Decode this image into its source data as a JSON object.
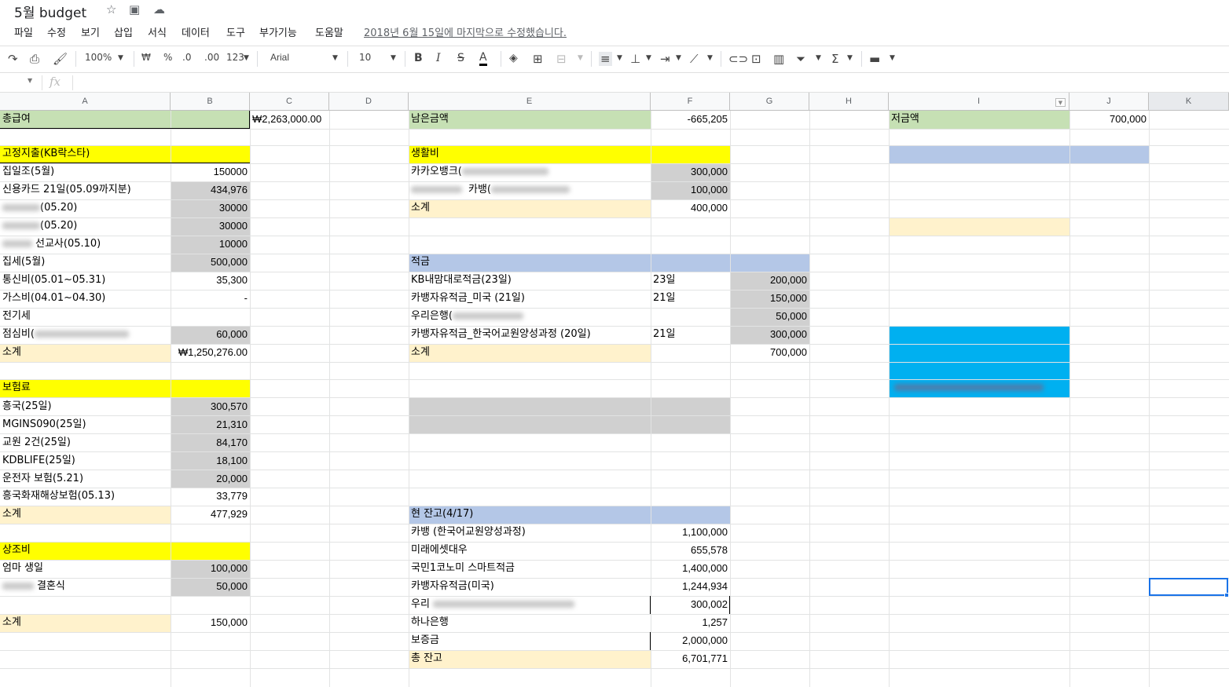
{
  "app": {
    "title": "5월 budget",
    "menus": [
      "파일",
      "수정",
      "보기",
      "삽입",
      "서식",
      "데이터",
      "도구",
      "부가기능",
      "도움말"
    ],
    "last_edit": "2018년 6월 15일에 마지막으로 수정했습니다."
  },
  "toolbar": {
    "zoom": "100%",
    "currency": "₩",
    "percent": "%",
    "dec_less": ".0",
    "dec_more": ".00",
    "format": "123",
    "font": "Arial",
    "font_size": "10"
  },
  "columns": [
    "A",
    "B",
    "C",
    "D",
    "E",
    "F",
    "G",
    "H",
    "I",
    "J",
    "K"
  ],
  "cells": {
    "a_total_pay": "총급여",
    "c_total_pay": "₩2,263,000.00",
    "e_remaining": "남은금액",
    "f_remaining": "-665,205",
    "i_savings": "저금액",
    "j_savings": "700,000",
    "a_fixed": "고정지출(KB락스타)",
    "a_r1": "집일조(5월)",
    "b_r1": "150000",
    "a_r2": "신용카드 21일(05.09까지분)",
    "b_r2": "434,976",
    "a_r3": "(05.20)",
    "b_r3": "30000",
    "a_r4": "(05.20)",
    "b_r4": "30000",
    "a_r5": "선교사(05.10)",
    "b_r5": "10000",
    "a_r6": "집세(5월)",
    "b_r6": "500,000",
    "a_r7": "통신비(05.01~05.31)",
    "b_r7": "35,300",
    "a_r8": "가스비(04.01~04.30)",
    "b_r8": "-",
    "a_r9": "전기세",
    "a_r10": "점심비(",
    "b_r10": "60,000",
    "a_sub1": "소계",
    "b_sub1": "₩1,250,276.00",
    "a_ins": "보험료",
    "a_i1": "흥국(25일)",
    "b_i1": "300,570",
    "a_i2": "MGINS090(25일)",
    "b_i2": "21,310",
    "a_i3": "교원 2건(25일)",
    "b_i3": "84,170",
    "a_i4": "KDBLIFE(25일)",
    "b_i4": "18,100",
    "a_i5": "운전자 보험(5.21)",
    "b_i5": "20,000",
    "a_i6": "흥국화재해상보험(05.13)",
    "b_i6": "33,779",
    "a_sub2": "소계",
    "b_sub2": "477,929",
    "a_cond": "상조비",
    "a_c1": "엄마 생일",
    "b_c1": "100,000",
    "a_c2": "결혼식",
    "b_c2": "50,000",
    "a_sub3": "소계",
    "b_sub3": "150,000",
    "e_living": "생활비",
    "e_l1": "카카오뱅크(",
    "f_l1": "300,000",
    "e_l2": "카뱅(",
    "f_l2": "100,000",
    "e_sub1": "소계",
    "f_sub1": "400,000",
    "e_sav": "적금",
    "e_s1": "KB내맘대로적금(23일)",
    "f_s1": "23일",
    "g_s1": "200,000",
    "e_s2": "카뱅자유적금_미국 (21일)",
    "f_s2": "21일",
    "g_s2": "150,000",
    "e_s3": "우리은행(",
    "g_s3": "50,000",
    "e_s4": "카뱅자유적금_한국어교원양성과정 (20일)",
    "f_s4": "21일",
    "g_s4": "300,000",
    "e_sub2": "소계",
    "g_sub2": "700,000",
    "e_bal": "현 잔고(4/17)",
    "e_b1": "카뱅 (한국어교원양성과정)",
    "f_b1": "1,100,000",
    "e_b2": "미래에셋대우",
    "f_b2": "655,578",
    "e_b3": "국민1코노미 스마트적금",
    "f_b3": "1,400,000",
    "e_b4": "카뱅자유적금(미국)",
    "f_b4": "1,244,934",
    "e_b5": "우리",
    "f_b5": "300,002",
    "e_b6": "하나은행",
    "f_b6": "1,257",
    "e_b7": "보증금",
    "f_b7": "2,000,000",
    "e_total": "총 잔고",
    "f_total": "6,701,771"
  },
  "colors": {
    "green": "#c6e0b4",
    "yellow": "#ffff00",
    "peach": "#fff2cc",
    "blue": "#b4c7e7",
    "gray": "#d0d0d0",
    "cyan": "#00b0f0",
    "selection": "#1a73e8"
  }
}
